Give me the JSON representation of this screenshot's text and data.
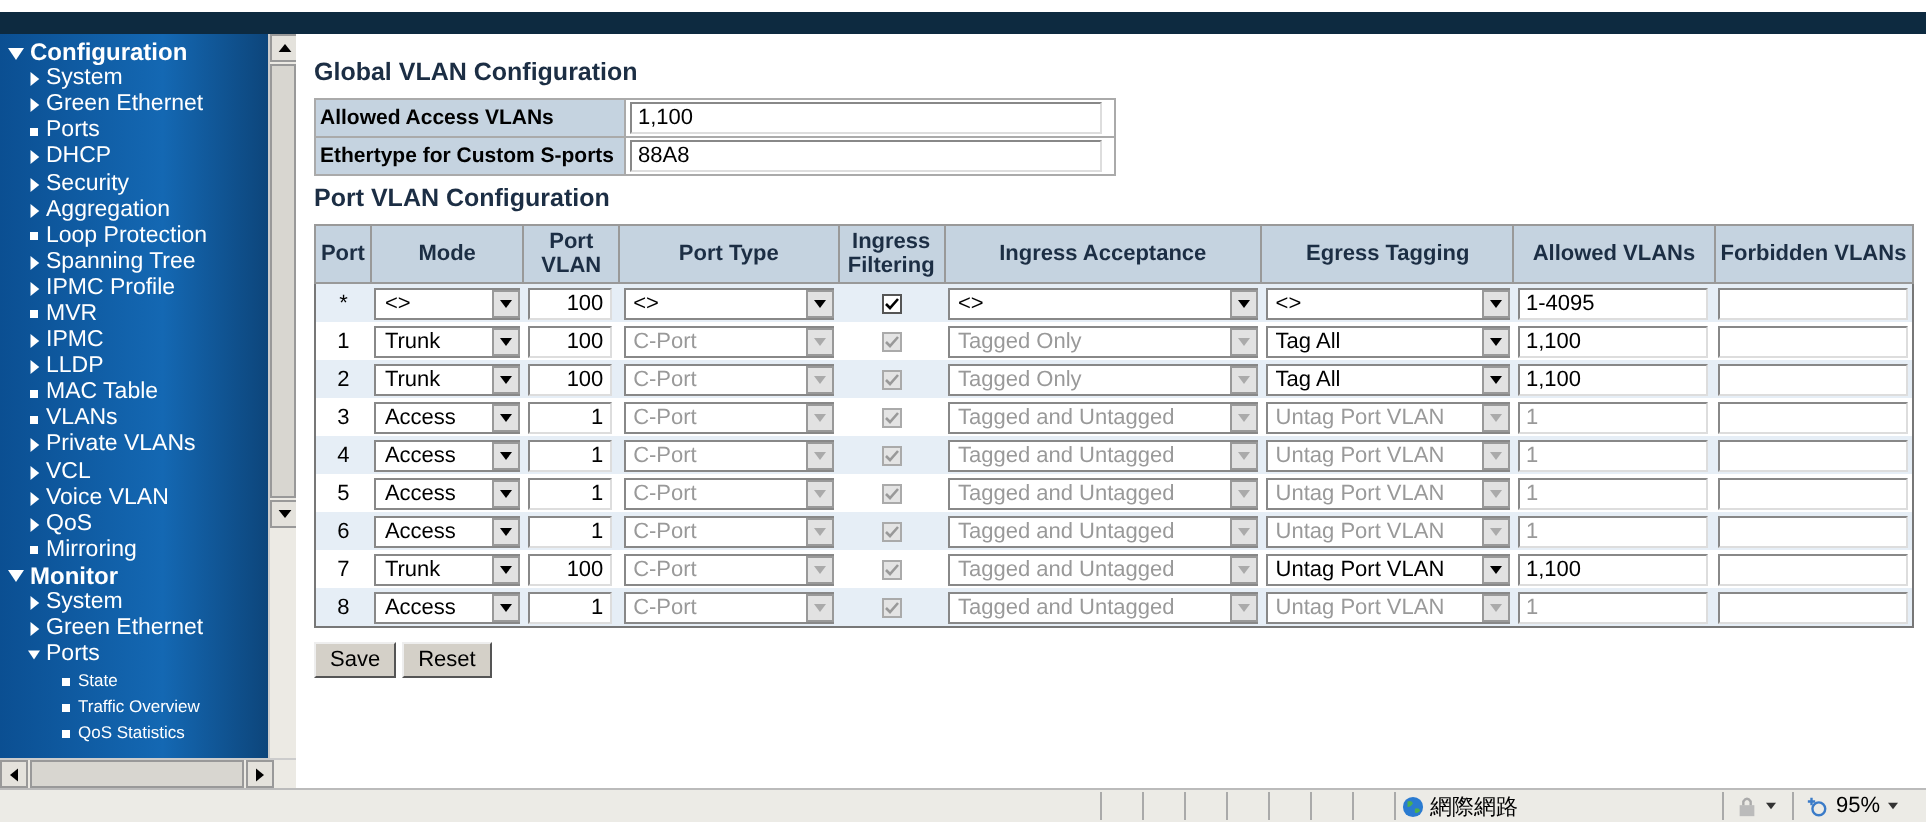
{
  "sidebar": {
    "items": [
      {
        "label": "Configuration",
        "kind": "section",
        "expanded": true,
        "children": [
          {
            "label": "System",
            "kind": "folder",
            "expanded": false
          },
          {
            "label": "Green Ethernet",
            "kind": "folder",
            "expanded": false
          },
          {
            "label": "Ports",
            "kind": "page"
          },
          {
            "label": "DHCP",
            "kind": "folder",
            "expanded": false
          },
          {
            "label": "Security",
            "kind": "folder",
            "expanded": false
          },
          {
            "label": "Aggregation",
            "kind": "folder",
            "expanded": false
          },
          {
            "label": "Loop Protection",
            "kind": "page"
          },
          {
            "label": "Spanning Tree",
            "kind": "folder",
            "expanded": false
          },
          {
            "label": "IPMC Profile",
            "kind": "folder",
            "expanded": false
          },
          {
            "label": "MVR",
            "kind": "page"
          },
          {
            "label": "IPMC",
            "kind": "folder",
            "expanded": false
          },
          {
            "label": "LLDP",
            "kind": "folder",
            "expanded": false
          },
          {
            "label": "MAC Table",
            "kind": "page"
          },
          {
            "label": "VLANs",
            "kind": "page"
          },
          {
            "label": "Private VLANs",
            "kind": "folder",
            "expanded": false
          },
          {
            "label": "VCL",
            "kind": "folder",
            "expanded": false
          },
          {
            "label": "Voice VLAN",
            "kind": "folder",
            "expanded": false
          },
          {
            "label": "QoS",
            "kind": "folder",
            "expanded": false
          },
          {
            "label": "Mirroring",
            "kind": "page"
          }
        ]
      },
      {
        "label": "Monitor",
        "kind": "section",
        "expanded": true,
        "children": [
          {
            "label": "System",
            "kind": "folder",
            "expanded": false
          },
          {
            "label": "Green Ethernet",
            "kind": "folder",
            "expanded": false
          },
          {
            "label": "Ports",
            "kind": "folder",
            "expanded": true,
            "children": [
              {
                "label": "State",
                "kind": "page"
              },
              {
                "label": "Traffic Overview",
                "kind": "page"
              },
              {
                "label": "QoS Statistics",
                "kind": "page"
              }
            ]
          }
        ]
      }
    ]
  },
  "global": {
    "title": "Global VLAN Configuration",
    "rows": [
      {
        "label": "Allowed Access VLANs",
        "value": "1,100"
      },
      {
        "label": "Ethertype for Custom S-ports",
        "value": "88A8"
      }
    ]
  },
  "port_vlan": {
    "title": "Port VLAN Configuration",
    "columns": [
      "Port",
      "Mode",
      "Port VLAN",
      "Port Type",
      "Ingress Filtering",
      "Ingress Acceptance",
      "Egress Tagging",
      "Allowed VLANs",
      "Forbidden VLANs"
    ],
    "rows": [
      {
        "port": "*",
        "mode": "<>",
        "port_vlan": "100",
        "port_type": {
          "value": "<>",
          "disabled": false
        },
        "ingress_filtering": {
          "checked": true,
          "disabled": false
        },
        "ingress_acceptance": {
          "value": "<>",
          "disabled": false
        },
        "egress_tagging": {
          "value": "<>",
          "disabled": false
        },
        "allowed_vlans": {
          "value": "1-4095",
          "disabled": false
        }
      },
      {
        "port": "1",
        "mode": "Trunk",
        "port_vlan": "100",
        "port_type": {
          "value": "C-Port",
          "disabled": true
        },
        "ingress_filtering": {
          "checked": true,
          "disabled": true
        },
        "ingress_acceptance": {
          "value": "Tagged Only",
          "disabled": true
        },
        "egress_tagging": {
          "value": "Tag All",
          "disabled": false
        },
        "allowed_vlans": {
          "value": "1,100",
          "disabled": false
        }
      },
      {
        "port": "2",
        "mode": "Trunk",
        "port_vlan": "100",
        "port_type": {
          "value": "C-Port",
          "disabled": true
        },
        "ingress_filtering": {
          "checked": true,
          "disabled": true
        },
        "ingress_acceptance": {
          "value": "Tagged Only",
          "disabled": true
        },
        "egress_tagging": {
          "value": "Tag All",
          "disabled": false
        },
        "allowed_vlans": {
          "value": "1,100",
          "disabled": false
        }
      },
      {
        "port": "3",
        "mode": "Access",
        "port_vlan": "1",
        "port_type": {
          "value": "C-Port",
          "disabled": true
        },
        "ingress_filtering": {
          "checked": true,
          "disabled": true
        },
        "ingress_acceptance": {
          "value": "Tagged and Untagged",
          "disabled": true
        },
        "egress_tagging": {
          "value": "Untag Port VLAN",
          "disabled": true
        },
        "allowed_vlans": {
          "value": "1",
          "disabled": true
        }
      },
      {
        "port": "4",
        "mode": "Access",
        "port_vlan": "1",
        "port_type": {
          "value": "C-Port",
          "disabled": true
        },
        "ingress_filtering": {
          "checked": true,
          "disabled": true
        },
        "ingress_acceptance": {
          "value": "Tagged and Untagged",
          "disabled": true
        },
        "egress_tagging": {
          "value": "Untag Port VLAN",
          "disabled": true
        },
        "allowed_vlans": {
          "value": "1",
          "disabled": true
        }
      },
      {
        "port": "5",
        "mode": "Access",
        "port_vlan": "1",
        "port_type": {
          "value": "C-Port",
          "disabled": true
        },
        "ingress_filtering": {
          "checked": true,
          "disabled": true
        },
        "ingress_acceptance": {
          "value": "Tagged and Untagged",
          "disabled": true
        },
        "egress_tagging": {
          "value": "Untag Port VLAN",
          "disabled": true
        },
        "allowed_vlans": {
          "value": "1",
          "disabled": true
        }
      },
      {
        "port": "6",
        "mode": "Access",
        "port_vlan": "1",
        "port_type": {
          "value": "C-Port",
          "disabled": true
        },
        "ingress_filtering": {
          "checked": true,
          "disabled": true
        },
        "ingress_acceptance": {
          "value": "Tagged and Untagged",
          "disabled": true
        },
        "egress_tagging": {
          "value": "Untag Port VLAN",
          "disabled": true
        },
        "allowed_vlans": {
          "value": "1",
          "disabled": true
        }
      },
      {
        "port": "7",
        "mode": "Trunk",
        "port_vlan": "100",
        "port_type": {
          "value": "C-Port",
          "disabled": true
        },
        "ingress_filtering": {
          "checked": true,
          "disabled": true
        },
        "ingress_acceptance": {
          "value": "Tagged and Untagged",
          "disabled": true
        },
        "egress_tagging": {
          "value": "Untag Port VLAN",
          "disabled": false
        },
        "allowed_vlans": {
          "value": "1,100",
          "disabled": false
        }
      },
      {
        "port": "8",
        "mode": "Access",
        "port_vlan": "1",
        "port_type": {
          "value": "C-Port",
          "disabled": true
        },
        "ingress_filtering": {
          "checked": true,
          "disabled": true
        },
        "ingress_acceptance": {
          "value": "Tagged and Untagged",
          "disabled": true
        },
        "egress_tagging": {
          "value": "Untag Port VLAN",
          "disabled": true
        },
        "allowed_vlans": {
          "value": "1",
          "disabled": true
        }
      }
    ]
  },
  "buttons": [
    "Save",
    "Reset"
  ],
  "status_bar": {
    "zone": "網際網路",
    "zoom": "95%"
  }
}
